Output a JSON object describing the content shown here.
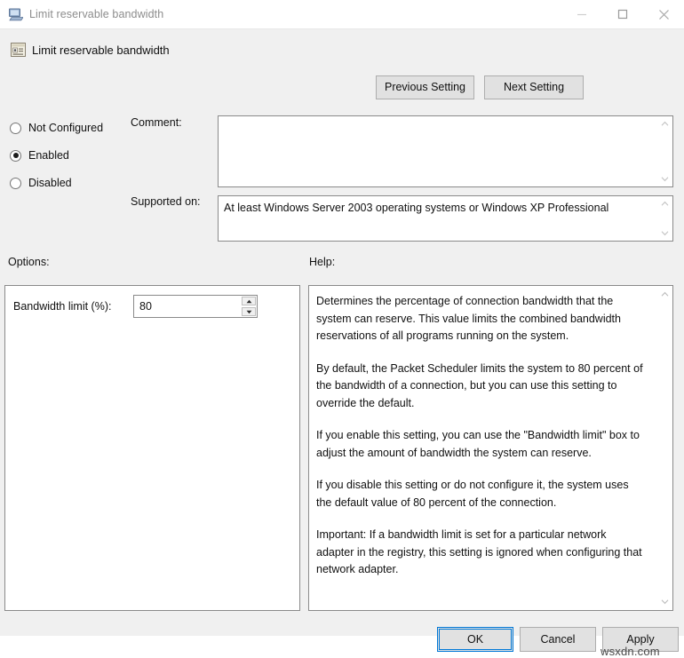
{
  "window": {
    "title": "Limit reservable bandwidth",
    "icon": "computer-icon",
    "controls": {
      "minimize": "–",
      "maximize": "□",
      "close": "✕"
    }
  },
  "header": {
    "title": "Limit reservable bandwidth",
    "icon": "policy-setting-icon",
    "previous_label": "Previous Setting",
    "next_label": "Next Setting"
  },
  "state": {
    "options": [
      {
        "label": "Not Configured",
        "checked": false
      },
      {
        "label": "Enabled",
        "checked": true
      },
      {
        "label": "Disabled",
        "checked": false
      }
    ]
  },
  "comment": {
    "label": "Comment:",
    "value": "",
    "placeholder": ""
  },
  "supported": {
    "label": "Supported on:",
    "value": "At least Windows Server 2003 operating systems or Windows XP Professional"
  },
  "options_panel": {
    "label": "Options:",
    "bandwidth_label": "Bandwidth limit (%):",
    "bandwidth_value": "80",
    "spin_up": "▲",
    "spin_down": "▼"
  },
  "help_panel": {
    "label": "Help:",
    "paragraphs": [
      "Determines the percentage of connection bandwidth that the system can reserve. This value limits the combined bandwidth reservations of all programs running on the system.",
      "By default, the Packet Scheduler limits the system to 80 percent of the bandwidth of a connection, but you can use this setting to override the default.",
      "If you enable this setting, you can use the \"Bandwidth limit\" box to adjust the amount of bandwidth the system can reserve.",
      "If you disable this setting or do not configure it, the system uses the default value of 80 percent of the connection.",
      "Important: If a bandwidth limit is set for a particular network adapter in the registry, this setting is ignored when configuring that network adapter."
    ]
  },
  "footer": {
    "ok_label": "OK",
    "cancel_label": "Cancel",
    "apply_label": "Apply"
  },
  "watermark": "wsxdn.com",
  "colors": {
    "accent": "#0078d7",
    "window_bg": "#f0f0f0",
    "field_bg": "#ffffff",
    "button_bg": "#e1e1e1",
    "border": "#8a8a8a"
  }
}
